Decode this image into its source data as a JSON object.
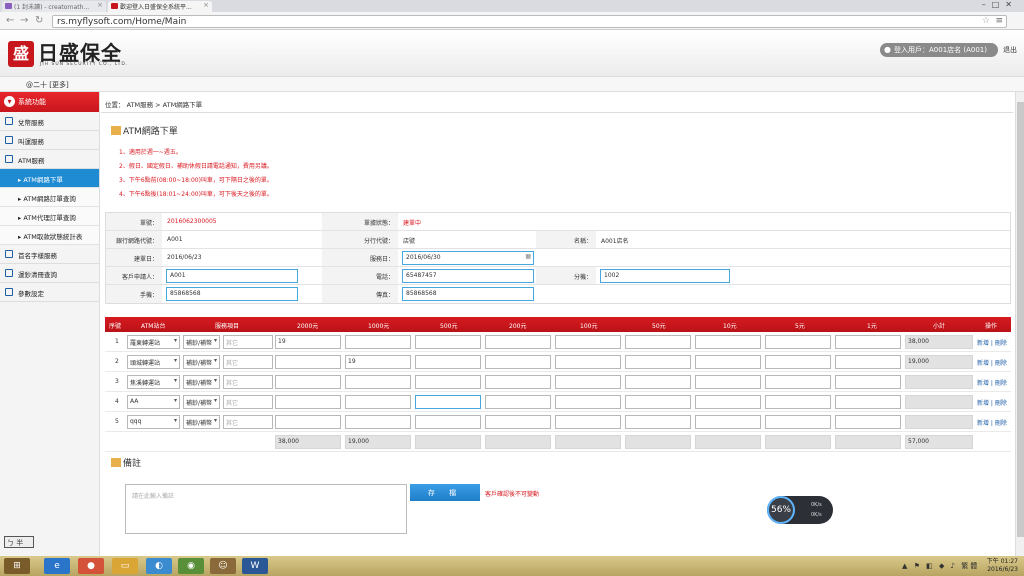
{
  "browser": {
    "tabs": [
      {
        "label": "(1 封未讀) - creatornath..."
      },
      {
        "label": "歡迎登入日盛保全系統平..."
      }
    ],
    "url": "rs.myflysoft.com/Home/Main"
  },
  "header": {
    "logo_char": "盛",
    "brand": "日盛保全",
    "brand_sub": "JIH SUN SECURITY CO., LTD.",
    "user": "登入用戶：A001店名 (A001)",
    "logout": "退出"
  },
  "subbar": {
    "text": "@二十 [更多]"
  },
  "sidebar": {
    "head": "系統功能",
    "items": [
      {
        "label": "兌幣服務"
      },
      {
        "label": "叫運服務"
      },
      {
        "label": "ATM服務"
      },
      {
        "label": "ATM網路下單",
        "sub": true,
        "active": true
      },
      {
        "label": "ATM網路訂單查詢",
        "sub": true
      },
      {
        "label": "ATM代理訂單查詢",
        "sub": true
      },
      {
        "label": "ATM取款狀態統計表",
        "sub": true
      },
      {
        "label": "首名字樣服務"
      },
      {
        "label": "運鈔清冊查詢"
      },
      {
        "label": "參數設定"
      }
    ],
    "ime": "ㄅ 半"
  },
  "main": {
    "crumb": "位置： ATM服務 > ATM網路下單",
    "title": "ATM網路下單",
    "notes": [
      "1、適用於週一~週五。",
      "2、假日、國定假日、補助休假日請電話通知，費用另議。",
      "3、下午6點前(08:00~18:00)叫車，可下隔日之後的單。",
      "4、下午6點後(18:01~24:00)叫車，可下後天之後的單。"
    ],
    "form": {
      "order_no_label": "單號：",
      "order_no": "2016062300005",
      "status_label": "單據狀態：",
      "status": "建單中",
      "bank_label": "銀行網路代號：",
      "bank": "A001",
      "branch_label": "分行代號：",
      "branch": "店號",
      "name_label": "名稱：",
      "name": "A001店名",
      "created_label": "建單日：",
      "created": "2016/06/23",
      "service_label": "服務日：",
      "service": "2016/06/30",
      "customer_label": "客戶申請人：",
      "customer": "A001",
      "phone_label": "電話：",
      "phone": "65487457",
      "ext_label": "分機：",
      "ext": "1002",
      "mobile_label": "手機：",
      "mobile": "85868568",
      "fax_label": "傳真：",
      "fax": "85868568"
    },
    "grid": {
      "headers": [
        "序號",
        "ATM站台",
        "服務項目",
        "2000元",
        "1000元",
        "500元",
        "200元",
        "100元",
        "50元",
        "10元",
        "5元",
        "1元",
        "小計",
        "操作"
      ],
      "rows": [
        {
          "no": "1",
          "site": "羅東轉運站",
          "svc": "補鈔/補幣",
          "other": "其它",
          "c2000": "19",
          "c1000": "",
          "subtotal": "38,000"
        },
        {
          "no": "2",
          "site": "頭城轉運站",
          "svc": "補鈔/補幣",
          "other": "其它",
          "c2000": "",
          "c1000": "19",
          "subtotal": "19,000"
        },
        {
          "no": "3",
          "site": "焦溪轉運站",
          "svc": "補鈔/補幣",
          "other": "其它",
          "c2000": "",
          "c1000": "",
          "subtotal": ""
        },
        {
          "no": "4",
          "site": "AA",
          "svc": "補鈔/補幣",
          "other": "其它",
          "c2000": "",
          "c1000": "",
          "subtotal": ""
        },
        {
          "no": "5",
          "site": "qqq",
          "svc": "補鈔/補幣",
          "other": "其它",
          "c2000": "",
          "c1000": "",
          "subtotal": ""
        }
      ],
      "action": "新增 | 刪除",
      "totals": {
        "c2000": "38,000",
        "c1000": "19,000",
        "subtotal": "57,000"
      }
    },
    "remark_title": "備註",
    "remark_placeholder": "請在此輸入備註",
    "save": "存 檔",
    "save_hint": "客戶確認後不可變動",
    "speed": {
      "pct": "56%",
      "up": "0K/s",
      "down": "0K/s"
    }
  },
  "taskbar": {
    "time": "下午 01:27",
    "date": "2016/6/23",
    "lang": "繁體"
  }
}
